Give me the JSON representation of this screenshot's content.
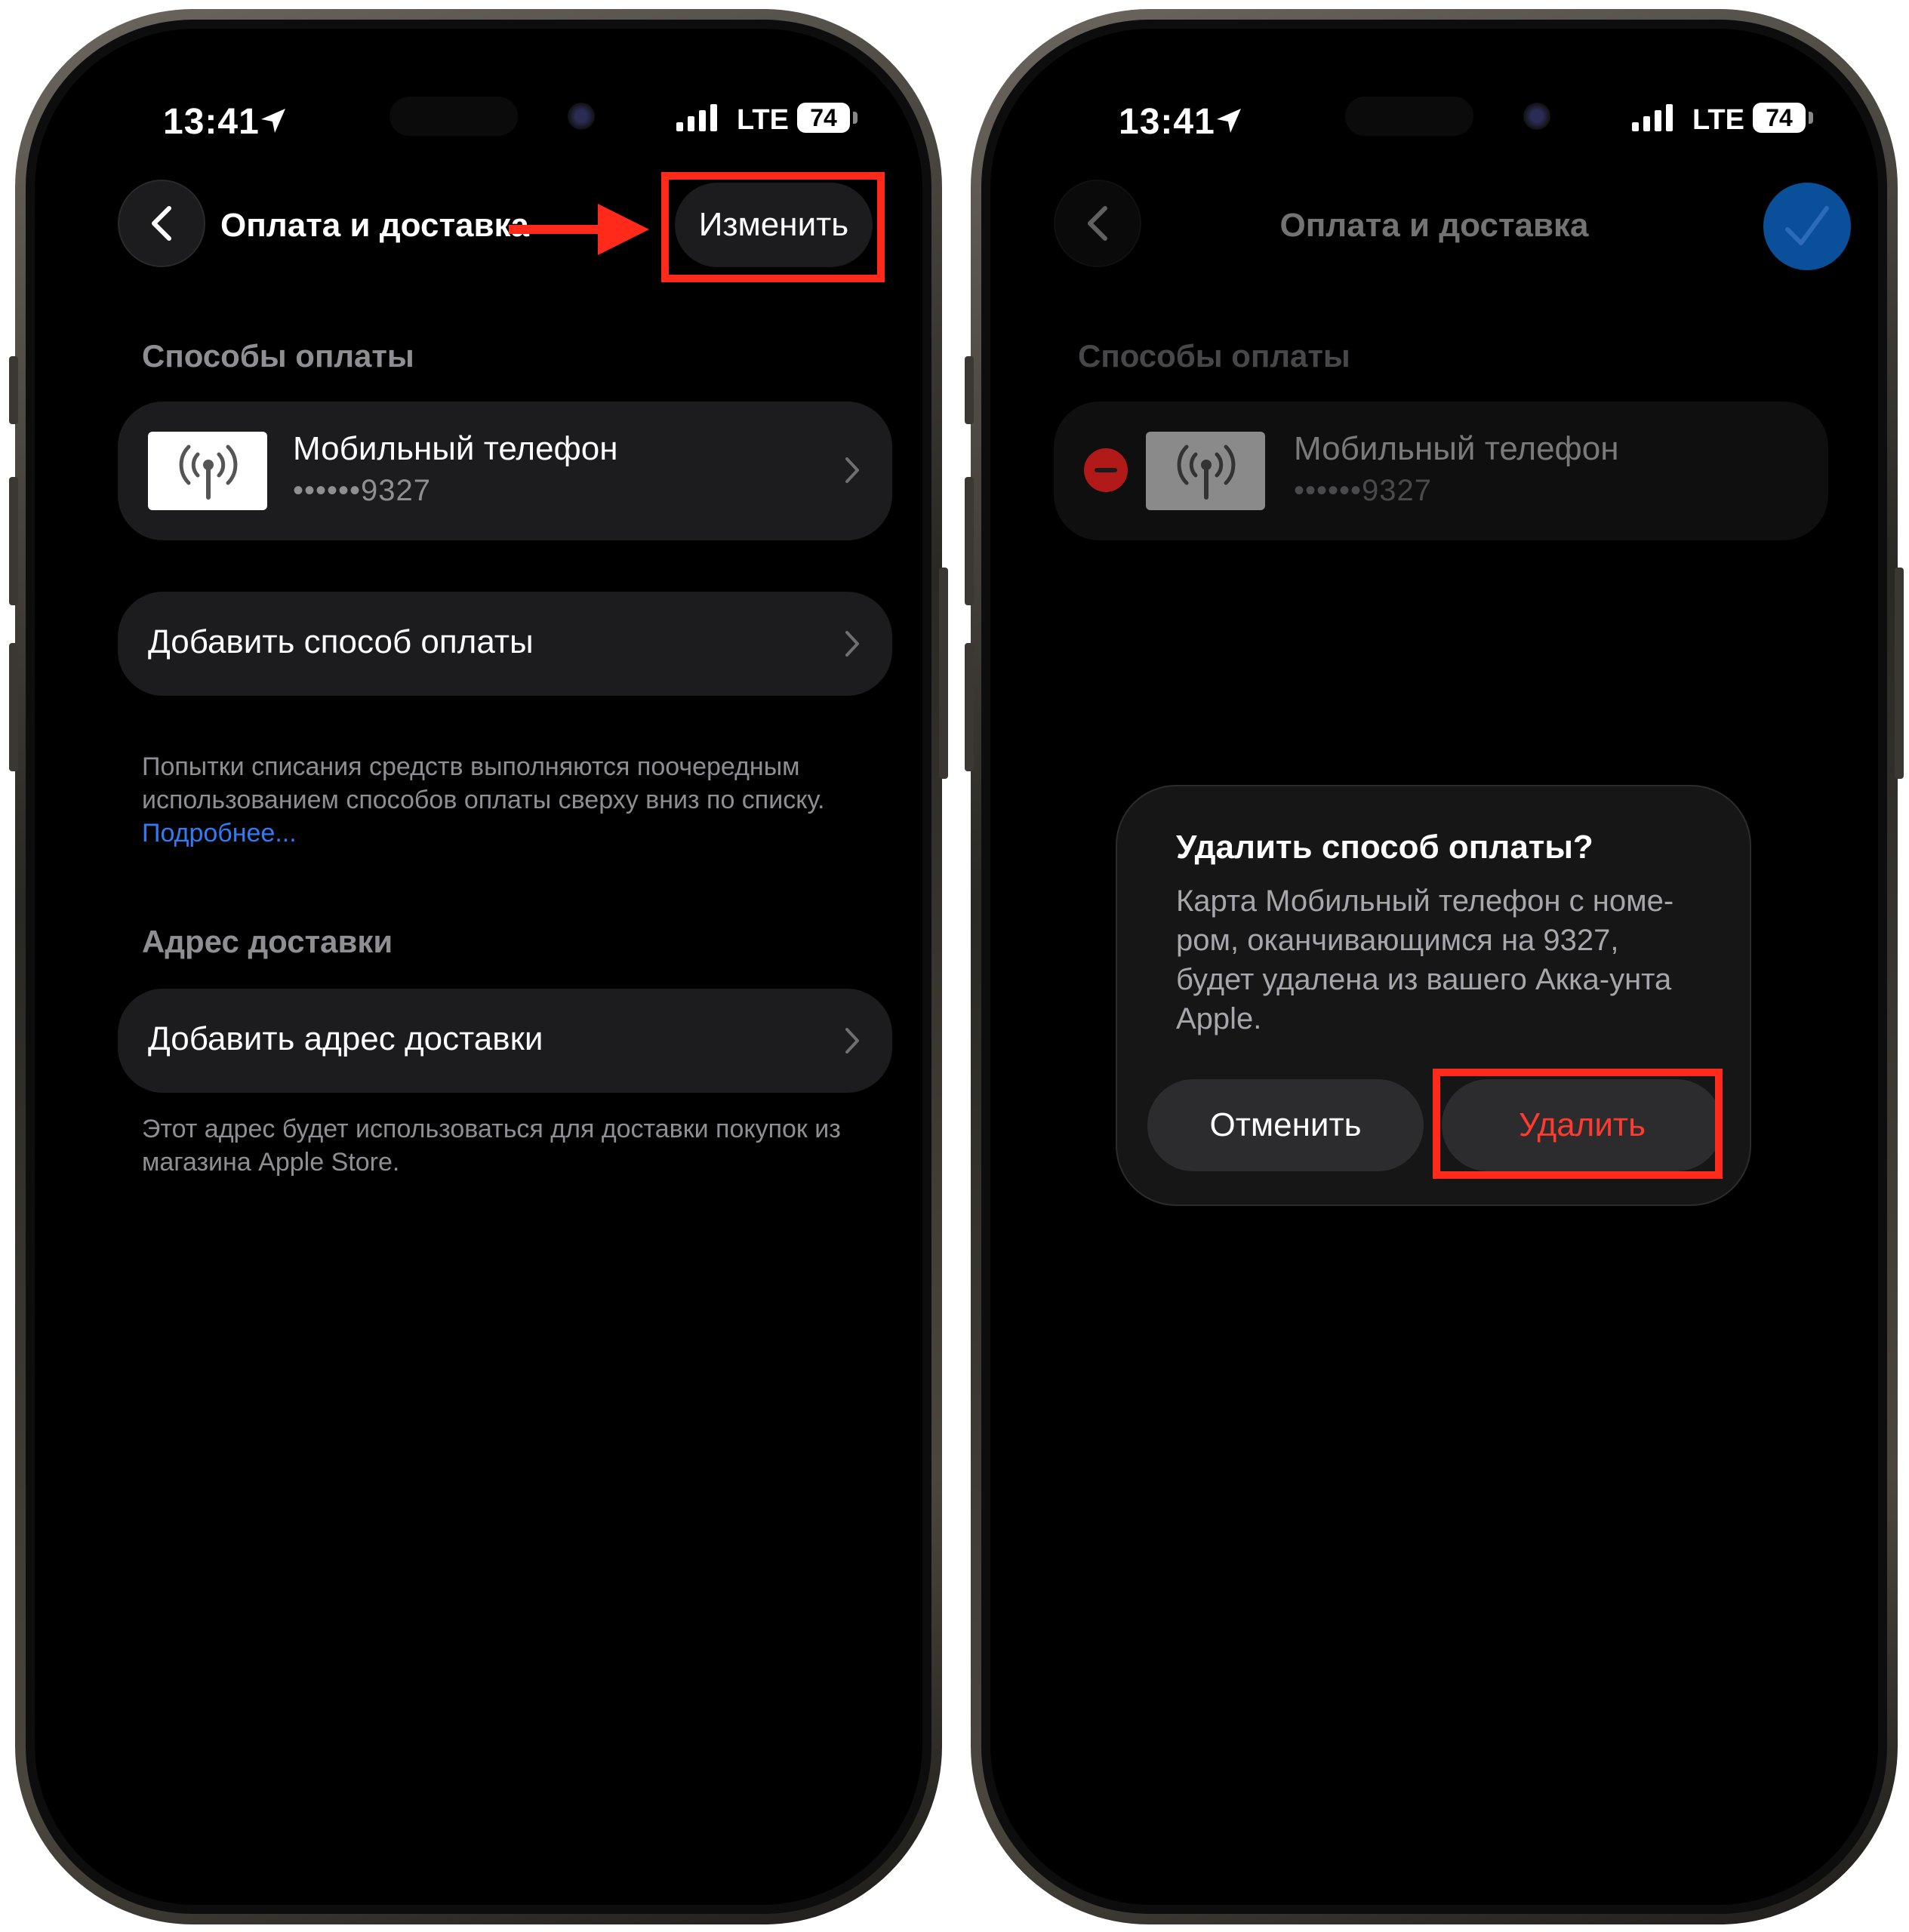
{
  "colors": {
    "accent_link": "#2f7df6",
    "destructive": "#ff3b30",
    "annotation": "#ff2a1a",
    "done_button": "#0a4f99"
  },
  "left_screen": {
    "status_bar": {
      "time": "13:41",
      "network": "LTE",
      "battery": "74"
    },
    "nav": {
      "back_icon": "chevron-left-icon",
      "title": "Оплата и доставка",
      "edit_label": "Изменить"
    },
    "payment": {
      "header": "Способы оплаты",
      "method": {
        "name": "Мобильный телефон",
        "number": "••••••9327",
        "icon": "antenna-icon"
      },
      "add_label": "Добавить способ оплаты",
      "footnote": "Попытки списания средств выполняются поочередным использованием способов оплаты сверху вниз по списку.",
      "footnote_link": "Подробнее..."
    },
    "shipping": {
      "header": "Адрес доставки",
      "add_label": "Добавить адрес доставки",
      "footnote": "Этот адрес будет использоваться для доставки покупок из магазина Apple Store."
    }
  },
  "right_screen": {
    "status_bar": {
      "time": "13:41",
      "network": "LTE",
      "battery": "74"
    },
    "nav": {
      "back_icon": "chevron-left-icon",
      "title": "Оплата и доставка",
      "done_icon": "checkmark-icon"
    },
    "payment": {
      "header": "Способы оплаты",
      "method": {
        "name": "Мобильный телефон",
        "number": "••••••9327"
      }
    },
    "dialog": {
      "title": "Удалить способ оплаты?",
      "body": "Карта Мобильный телефон с номе-ром, оканчивающимся на 9327, будет удалена из вашего Акка-унта Apple.",
      "cancel_label": "Отменить",
      "delete_label": "Удалить"
    }
  }
}
